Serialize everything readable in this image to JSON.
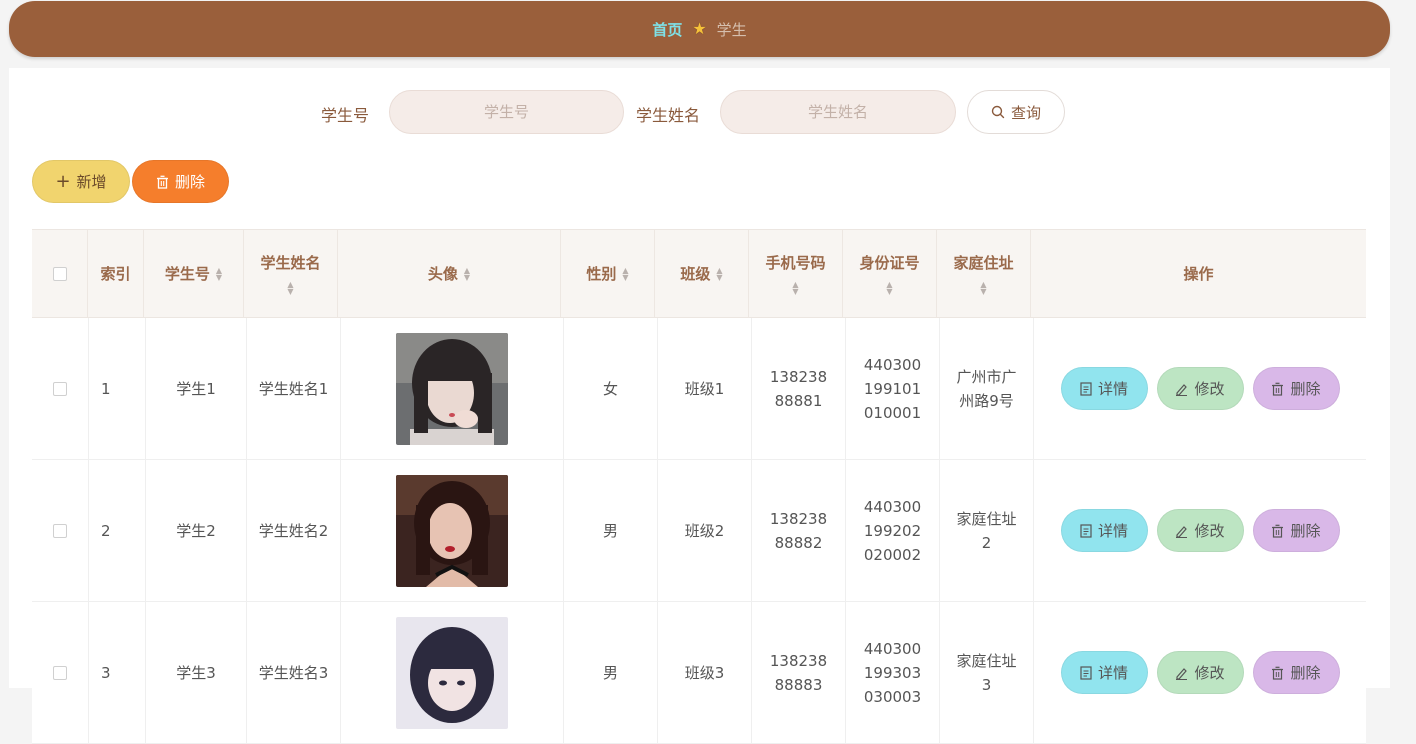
{
  "breadcrumb": {
    "home": "首页",
    "current": "学生"
  },
  "search": {
    "student_no_label": "学生号",
    "student_no_placeholder": "学生号",
    "student_name_label": "学生姓名",
    "student_name_placeholder": "学生姓名",
    "query_label": "查询"
  },
  "toolbar": {
    "add_label": "新增",
    "delete_label": "删除"
  },
  "table": {
    "headers": {
      "index": "索引",
      "student_no": "学生号",
      "student_name": "学生姓名",
      "avatar": "头像",
      "gender": "性别",
      "class": "班级",
      "phone": "手机号码",
      "id_card": "身份证号",
      "address": "家庭住址",
      "actions": "操作"
    },
    "rows": [
      {
        "index": "1",
        "student_no": "学生1",
        "student_name": "学生姓名1",
        "gender": "女",
        "class": "班级1",
        "phone": "13823888881",
        "id_card": "440300199101010001",
        "address": "广州市广州路9号"
      },
      {
        "index": "2",
        "student_no": "学生2",
        "student_name": "学生姓名2",
        "gender": "男",
        "class": "班级2",
        "phone": "13823888882",
        "id_card": "440300199202020002",
        "address": "家庭住址2"
      },
      {
        "index": "3",
        "student_no": "学生3",
        "student_name": "学生姓名3",
        "gender": "男",
        "class": "班级3",
        "phone": "13823888883",
        "id_card": "440300199303030003",
        "address": "家庭住址3"
      }
    ],
    "row_actions": {
      "detail": "详情",
      "edit": "修改",
      "delete": "删除"
    }
  },
  "colors": {
    "breadcrumb_bg": "#9a5f3b",
    "breadcrumb_home": "#7fe0e6",
    "add_button": "#f1d46e",
    "delete_button": "#f57e2c",
    "detail_button": "#91e4ee",
    "edit_button": "#bde5c3",
    "row_delete_button": "#d9b8e8"
  },
  "icons": [
    "star-icon",
    "search-icon",
    "plus-icon",
    "trash-icon",
    "document-icon",
    "pencil-icon",
    "sort-icon"
  ]
}
